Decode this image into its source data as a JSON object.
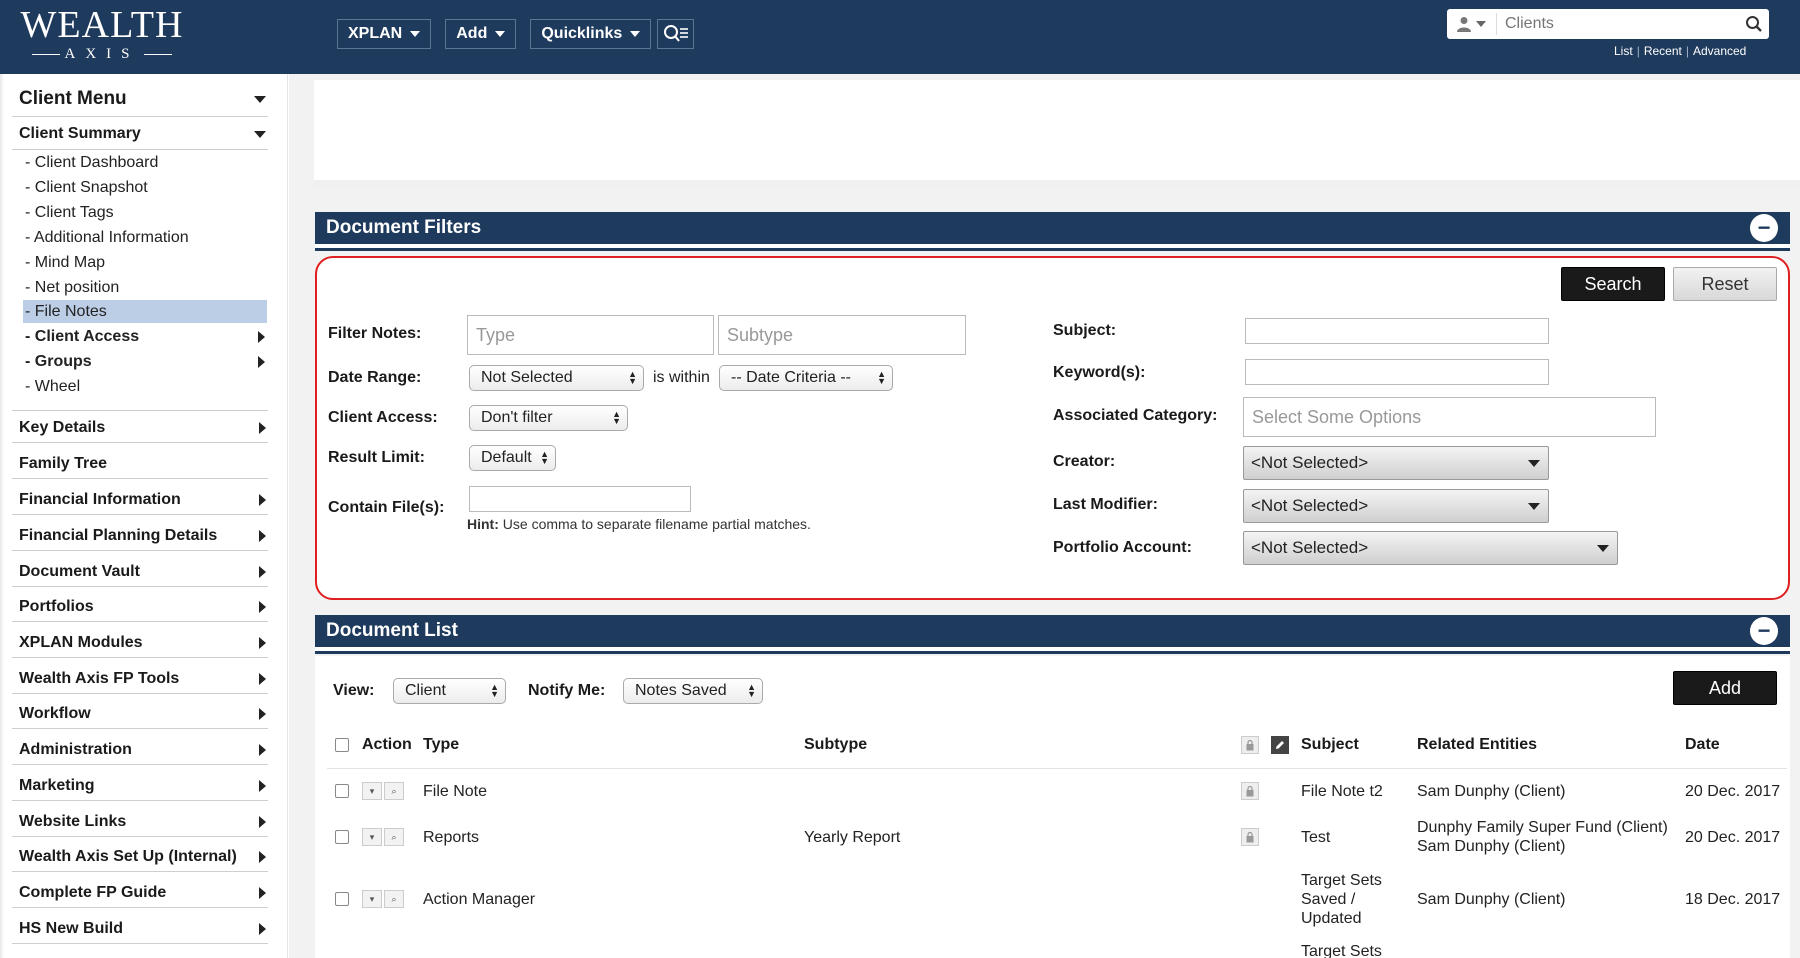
{
  "topbar": {
    "logo_main": "WEALTH",
    "logo_sub": "AXIS",
    "nav": [
      {
        "label": "XPLAN"
      },
      {
        "label": "Add"
      },
      {
        "label": "Quicklinks"
      }
    ],
    "client_search_placeholder": "Clients",
    "search_links": [
      "List",
      "Recent",
      "Advanced"
    ]
  },
  "sidebar": {
    "client_menu": "Client Menu",
    "client_summary": "Client Summary",
    "summary_items": [
      {
        "label": "- Client Dashboard"
      },
      {
        "label": "- Client Snapshot"
      },
      {
        "label": "- Client Tags"
      },
      {
        "label": "- Additional Information"
      },
      {
        "label": "- Mind Map"
      },
      {
        "label": "- Net position"
      },
      {
        "label": "- File Notes"
      },
      {
        "label": "- Client Access"
      },
      {
        "label": "- Groups"
      },
      {
        "label": "- Wheel"
      }
    ],
    "sections": [
      {
        "label": "Key Details"
      },
      {
        "label": "Family Tree"
      },
      {
        "label": "Financial Information"
      },
      {
        "label": "Financial Planning Details"
      },
      {
        "label": "Document Vault"
      },
      {
        "label": "Portfolios"
      },
      {
        "label": "XPLAN Modules"
      },
      {
        "label": "Wealth Axis FP Tools"
      },
      {
        "label": "Workflow"
      },
      {
        "label": "Administration"
      },
      {
        "label": "Marketing"
      },
      {
        "label": "Website Links"
      },
      {
        "label": "Wealth Axis Set Up (Internal)"
      },
      {
        "label": "Complete FP Guide"
      },
      {
        "label": "HS New Build"
      }
    ]
  },
  "filters": {
    "title": "Document Filters",
    "search_label": "Search",
    "reset_label": "Reset",
    "filter_notes_label": "Filter Notes:",
    "type_placeholder": "Type",
    "subtype_placeholder": "Subtype",
    "date_range_label": "Date Range:",
    "date_range_value": "Not Selected",
    "is_within": "is within",
    "date_criteria_value": "-- Date Criteria --",
    "client_access_label": "Client Access:",
    "client_access_value": "Don't filter",
    "result_limit_label": "Result Limit:",
    "result_limit_value": "Default",
    "contain_files_label": "Contain File(s):",
    "hint_bold": "Hint:",
    "hint_text": " Use comma to separate filename partial matches.",
    "subject_label": "Subject:",
    "keywords_label": "Keyword(s):",
    "assoc_category_label": "Associated Category:",
    "assoc_category_placeholder": "Select Some Options",
    "creator_label": "Creator:",
    "creator_value": "<Not Selected>",
    "last_modifier_label": "Last Modifier:",
    "last_modifier_value": "<Not Selected>",
    "portfolio_label": "Portfolio Account:",
    "portfolio_value": "<Not Selected>"
  },
  "list": {
    "title": "Document List",
    "view_label": "View:",
    "view_value": "Client",
    "notify_label": "Notify Me:",
    "notify_value": "Notes Saved",
    "add_label": "Add",
    "headers": {
      "action": "Action",
      "type": "Type",
      "subtype": "Subtype",
      "subject": "Subject",
      "related": "Related Entities",
      "date": "Date"
    },
    "rows": [
      {
        "type": "File Note",
        "subtype": "",
        "subject": "File Note t2",
        "related1": "Sam Dunphy (Client)",
        "related2": "",
        "date": "20 Dec. 2017"
      },
      {
        "type": "Reports",
        "subtype": "Yearly Report",
        "subject": "Test",
        "related1": "Dunphy Family Super Fund (Client)",
        "related2": "Sam Dunphy (Client)",
        "date": "20 Dec. 2017"
      },
      {
        "type": "Action Manager",
        "subtype": "",
        "subject": "Target Sets Saved / Updated",
        "related1": "Sam Dunphy (Client)",
        "related2": "",
        "date": "18 Dec. 2017"
      }
    ],
    "partial_row_subject": "Target Sets"
  }
}
